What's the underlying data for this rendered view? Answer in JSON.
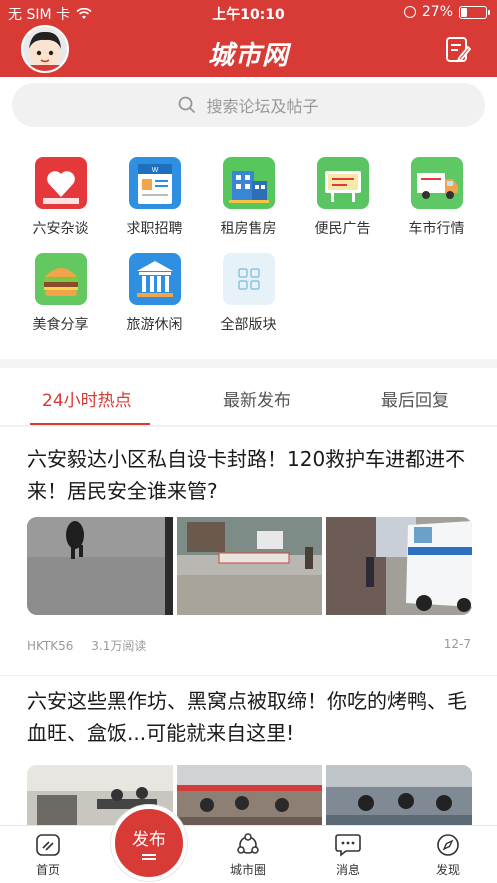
{
  "status": {
    "carrier": "无 SIM 卡",
    "time": "上午10:10",
    "battery": "27%",
    "battery_level": 0.27
  },
  "header": {
    "title": "城市网"
  },
  "search": {
    "placeholder": "搜索论坛及帖子"
  },
  "categories": [
    {
      "label": "六安杂谈",
      "icon": "heart-chat-icon",
      "color": "#e5383b"
    },
    {
      "label": "求职招聘",
      "icon": "word-resume-icon",
      "color": "#2f8fe0"
    },
    {
      "label": "租房售房",
      "icon": "building-icon",
      "color": "#57c75c"
    },
    {
      "label": "便民广告",
      "icon": "billboard-icon",
      "color": "#5ac463"
    },
    {
      "label": "车市行情",
      "icon": "truck-icon",
      "color": "#5ec865"
    },
    {
      "label": "美食分享",
      "icon": "burger-icon",
      "color": "#62c85f"
    },
    {
      "label": "旅游休闲",
      "icon": "museum-icon",
      "color": "#2f8fe0"
    },
    {
      "label": "全部版块",
      "icon": "grid-icon",
      "color": "#e6f2f8"
    }
  ],
  "tabs": [
    {
      "label": "24小时热点",
      "active": true
    },
    {
      "label": "最新发布",
      "active": false
    },
    {
      "label": "最后回复",
      "active": false
    }
  ],
  "posts": [
    {
      "title": "六安毅达小区私自设卡封路！120救护车进都进不来！居民安全谁来管?",
      "author": "HKTK56",
      "reads": "3.1万阅读",
      "date": "12-7"
    },
    {
      "title": "六安这些黑作坊、黑窝点被取缔！你吃的烤鸭、毛血旺、盒饭...可能就来自这里!"
    }
  ],
  "bottom_nav": {
    "home": "首页",
    "publish": "发布",
    "circle": "城市圈",
    "messages": "消息",
    "discover": "发现"
  },
  "colors": {
    "brand": "#d83a36"
  }
}
